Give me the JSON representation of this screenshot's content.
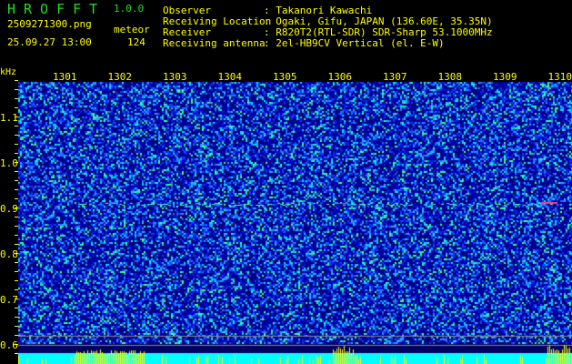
{
  "app": {
    "title": "HROFFT",
    "version": "1.0.0"
  },
  "file": {
    "name": "2509271300.png",
    "datetime": "25.09.27 13:00",
    "count_label": "meteor",
    "count": "124"
  },
  "info": [
    {
      "label": "Observer",
      "value": ": Takanori Kawachi"
    },
    {
      "label": "Receiving Location",
      "value": ": Ogaki, Gifu, JAPAN (136.60E, 35.35N)"
    },
    {
      "label": "Receiver",
      "value": ": R820T2(RTL-SDR) SDR-Sharp 53.1000MHz"
    },
    {
      "label": "Receiving antenna",
      "value": ": 2el-HB9CV Vertical (el. E-W)"
    }
  ],
  "axis": {
    "y_unit": "kHz",
    "y_ticks": [
      "1.1",
      "1.0",
      "0.9",
      "0.8",
      "0.7",
      "0.6"
    ],
    "x_ticks": [
      "1301",
      "1302",
      "1303",
      "1304",
      "1305",
      "1306",
      "1307",
      "1308",
      "1309",
      "1310"
    ]
  },
  "colors": {
    "background": "#000000",
    "text": "#ffff00",
    "title": "#22dd22",
    "noise": "#0a1ee0",
    "signal": "#00ffff",
    "level": "#ffff00"
  }
}
